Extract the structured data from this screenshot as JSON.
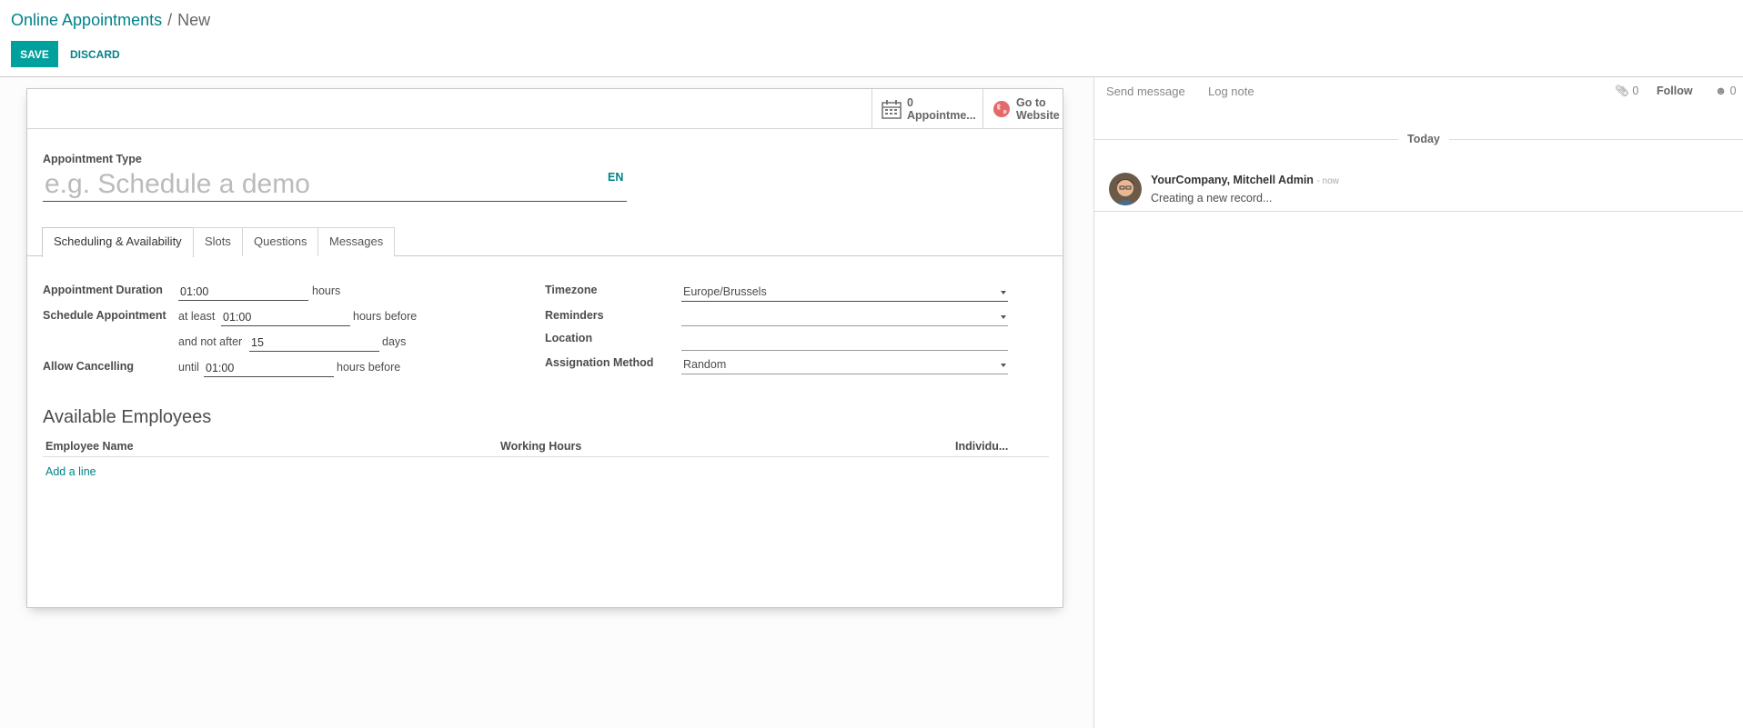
{
  "breadcrumb": {
    "parent": "Online Appointments",
    "separator": "/",
    "current": "New"
  },
  "actions": {
    "save": "SAVE",
    "discard": "DISCARD"
  },
  "stat_buttons": {
    "appointments": {
      "count": "0",
      "label": "Appointme..."
    },
    "website": {
      "line1": "Go to",
      "line2": "Website"
    }
  },
  "form": {
    "name_label": "Appointment Type",
    "name_placeholder": "e.g. Schedule a demo",
    "name_value": "",
    "lang": "EN",
    "tabs": [
      "Scheduling & Availability",
      "Slots",
      "Questions",
      "Messages"
    ],
    "duration": {
      "label": "Appointment Duration",
      "value": "01:00",
      "unit": "hours"
    },
    "schedule": {
      "label": "Schedule Appointment",
      "at_least_prefix": "at least",
      "at_least_value": "01:00",
      "at_least_suffix": "hours before",
      "not_after_prefix": "and not after",
      "not_after_value": "15",
      "not_after_suffix": "days"
    },
    "cancel": {
      "label": "Allow Cancelling",
      "prefix": "until",
      "value": "01:00",
      "suffix": "hours before"
    },
    "timezone": {
      "label": "Timezone",
      "value": "Europe/Brussels"
    },
    "reminders": {
      "label": "Reminders",
      "value": ""
    },
    "location": {
      "label": "Location",
      "value": ""
    },
    "assignation": {
      "label": "Assignation Method",
      "value": "Random"
    },
    "employees": {
      "title": "Available Employees",
      "columns": [
        "Employee Name",
        "Working Hours",
        "Individu..."
      ],
      "add_line": "Add a line"
    }
  },
  "chatter": {
    "send_message": "Send message",
    "log_note": "Log note",
    "attachments_count": "0",
    "follow": "Follow",
    "followers_count": "0",
    "today": "Today",
    "message": {
      "author": "YourCompany, Mitchell Admin",
      "date": "- now",
      "body": "Creating a new record..."
    }
  },
  "colors": {
    "primary": "#00a09d",
    "link": "#00828a"
  }
}
